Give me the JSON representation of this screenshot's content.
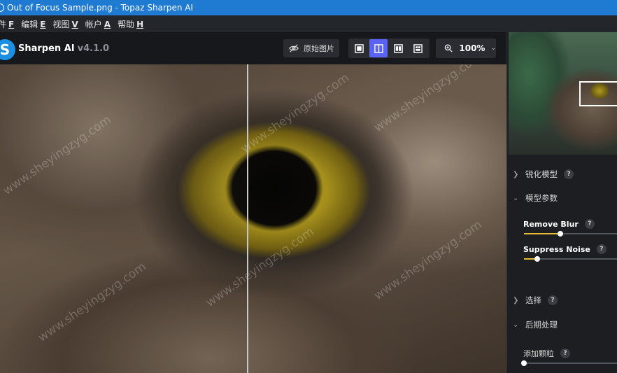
{
  "window": {
    "title": "Out of Focus Sample.png - Topaz Sharpen AI"
  },
  "menu": [
    {
      "label": "件",
      "key": "F"
    },
    {
      "label": "编辑",
      "key": "E"
    },
    {
      "label": "视图",
      "key": "V"
    },
    {
      "label": "帐户",
      "key": "A"
    },
    {
      "label": "帮助",
      "key": "H"
    }
  ],
  "header": {
    "logo_letter": "S",
    "app_name": "Sharpen AI",
    "version": "v4.1.0",
    "original_button": "原始图片",
    "zoom": "100%",
    "active_view_index": 1
  },
  "canvas": {
    "watermark": "www.sheyingzyg.com"
  },
  "panel": {
    "sections": {
      "sharpen_model": "锐化模型",
      "model_params": "模型参数",
      "select": "选择",
      "post_processing": "后期处理"
    },
    "sliders": {
      "remove_blur": {
        "label": "Remove Blur",
        "value": 0.39
      },
      "suppress_noise": {
        "label": "Suppress Noise",
        "value": 0.14
      },
      "add_grain": {
        "label": "添加颗粒",
        "value": 0.0
      }
    },
    "help": "?"
  },
  "colors": {
    "accent": "#5a63f2",
    "slider_fill": "#e8b935",
    "titlebar": "#1f7ad1"
  }
}
